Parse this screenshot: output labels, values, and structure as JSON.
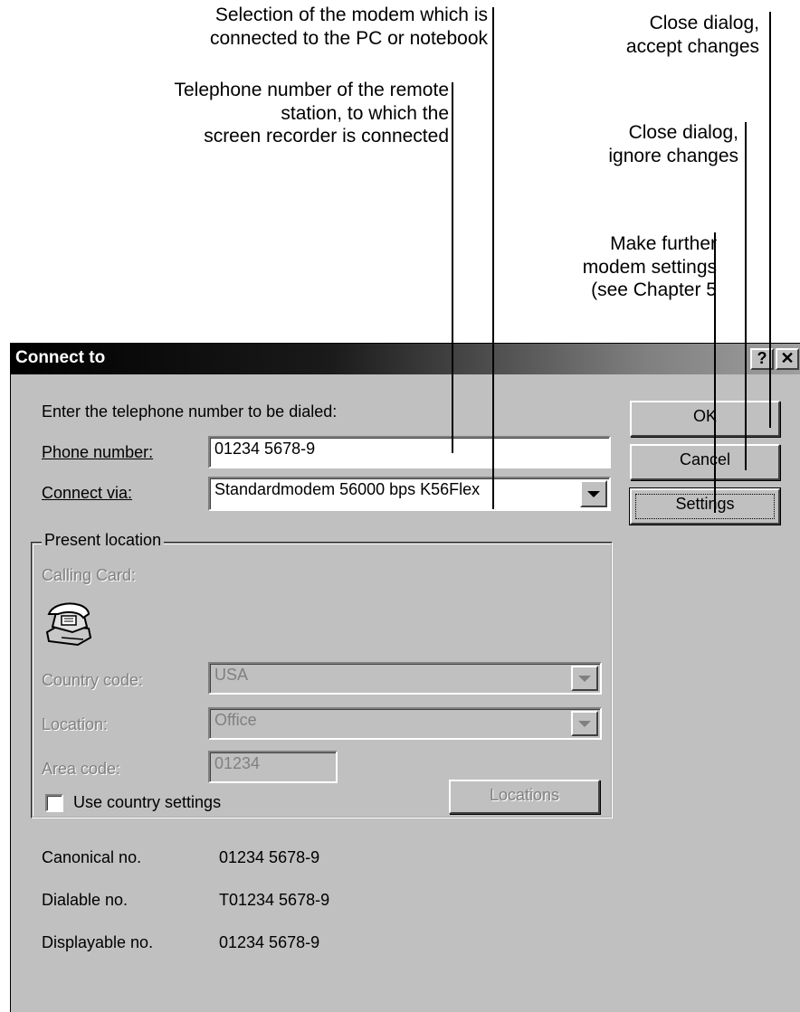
{
  "annotations": {
    "modem": [
      "Selection of the modem which is",
      "connected to the PC or notebook"
    ],
    "phone": [
      "Telephone number of the remote",
      "station, to which the",
      "screen recorder is connected"
    ],
    "ok": [
      "Close dialog,",
      "accept changes"
    ],
    "cancel": [
      "Close dialog,",
      "ignore changes"
    ],
    "settings": [
      "Make further",
      "modem settings",
      "(see Chapter 5"
    ]
  },
  "dialog": {
    "title": "Connect to",
    "help_button": "?",
    "close_button": "✕",
    "prompt": "Enter the telephone number to be dialed:",
    "phone_label": "Phone number:",
    "phone_value": "01234 5678-9",
    "connect_label": "Connect via:",
    "connect_value": "Standardmodem 56000 bps K56Flex",
    "group_label": "Present location",
    "calling_card_label": "Calling Card:",
    "country_label": "Country code:",
    "country_value": "USA",
    "location_label": "Location:",
    "location_value": "Office",
    "area_label": "Area code:",
    "area_value": "01234",
    "use_country_label": "Use country settings",
    "locations_button": "Locations",
    "ok_button": "OK",
    "cancel_button": "Cancel",
    "settings_button": "Settings",
    "canonical_label": "Canonical no.",
    "canonical_value": "01234 5678-9",
    "dialable_label": "Dialable no.",
    "dialable_value": "T01234 5678-9",
    "displayable_label": "Displayable no.",
    "displayable_value": "01234 5678-9"
  }
}
